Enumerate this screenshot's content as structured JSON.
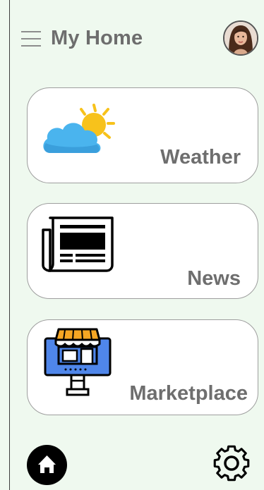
{
  "header": {
    "title": "My Home",
    "menu_icon": "hamburger-menu-icon",
    "avatar": "user-avatar"
  },
  "cards": [
    {
      "label": "Weather",
      "icon": "weather-partly-cloudy-icon"
    },
    {
      "label": "News",
      "icon": "newspaper-icon"
    },
    {
      "label": "Marketplace",
      "icon": "storefront-icon"
    }
  ],
  "bottom_nav": {
    "home_icon": "home-icon",
    "settings_icon": "gear-icon"
  },
  "colors": {
    "background": "#eff9ef",
    "card": "#ffffff",
    "text": "#6d6d6d",
    "sun": "#f7c21b",
    "cloud": "#4ab4ee",
    "store_blue": "#4f86ea",
    "awning": "#f6a623"
  }
}
